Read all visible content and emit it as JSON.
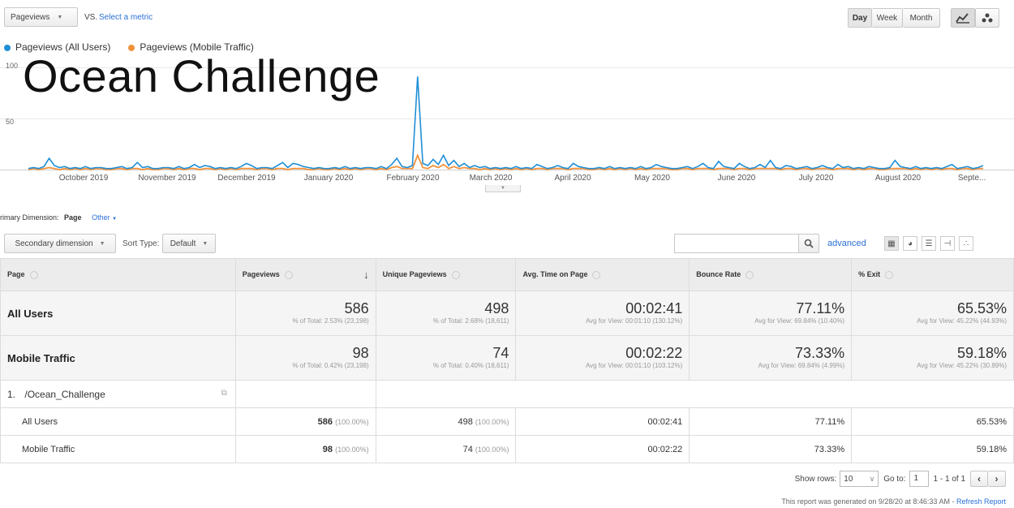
{
  "top": {
    "metric1": "Pageviews",
    "vs": "VS.",
    "select_metric": "Select a metric",
    "granularity": [
      "Day",
      "Week",
      "Month"
    ]
  },
  "legend": {
    "series1": "Pageviews (All Users)",
    "series2": "Pageviews (Mobile Traffic)",
    "series1_color": "#1f8fd6",
    "series2_color": "#f2913a"
  },
  "overlay_title": "Ocean Challenge",
  "chart_data": {
    "type": "line",
    "y_ticks": [
      "100",
      "50"
    ],
    "ylim": [
      0,
      100
    ],
    "x_labels": [
      "October 2019",
      "November 2019",
      "December 2019",
      "January 2020",
      "February 2020",
      "March 2020",
      "April 2020",
      "May 2020",
      "June 2020",
      "July 2020",
      "August 2020",
      "Septe..."
    ],
    "series": [
      {
        "name": "Pageviews (All Users)",
        "color": "#1f8fd6",
        "values": [
          1,
          2,
          1,
          3,
          11,
          4,
          2,
          3,
          1,
          2,
          1,
          3,
          1,
          2,
          2,
          1,
          1,
          2,
          3,
          1,
          2,
          7,
          2,
          3,
          1,
          1,
          2,
          2,
          1,
          3,
          1,
          2,
          5,
          2,
          4,
          3,
          1,
          2,
          1,
          2,
          1,
          3,
          6,
          4,
          1,
          2,
          2,
          1,
          4,
          7,
          2,
          6,
          5,
          3,
          2,
          1,
          2,
          1,
          1,
          2,
          1,
          3,
          1,
          2,
          1,
          2,
          2,
          1,
          3,
          1,
          5,
          11,
          3,
          2,
          4,
          91,
          6,
          4,
          10,
          5,
          14,
          4,
          9,
          3,
          6,
          2,
          4,
          2,
          3,
          1,
          2,
          1,
          2,
          1,
          3,
          1,
          2,
          1,
          5,
          3,
          1,
          2,
          4,
          2,
          1,
          6,
          3,
          2,
          1,
          1,
          2,
          1,
          3,
          1,
          2,
          1,
          2,
          1,
          3,
          1,
          2,
          5,
          3,
          2,
          1,
          1,
          2,
          3,
          1,
          3,
          6,
          2,
          1,
          8,
          3,
          2,
          1,
          6,
          3,
          1,
          2,
          5,
          2,
          9,
          2,
          1,
          4,
          3,
          1,
          2,
          3,
          1,
          2,
          4,
          2,
          1,
          5,
          2,
          3,
          1,
          2,
          1,
          3,
          2,
          1,
          1,
          2,
          9,
          3,
          2,
          1,
          3,
          1,
          2,
          1,
          2,
          1,
          3,
          5,
          1,
          2,
          3,
          1,
          2,
          4
        ]
      },
      {
        "name": "Pageviews (Mobile Traffic)",
        "color": "#f2913a",
        "values": [
          0,
          1,
          0,
          1,
          2,
          1,
          0,
          1,
          0,
          1,
          0,
          1,
          0,
          1,
          1,
          0,
          0,
          1,
          1,
          0,
          1,
          1,
          0,
          1,
          0,
          0,
          1,
          1,
          0,
          1,
          0,
          1,
          1,
          0,
          1,
          1,
          0,
          1,
          0,
          1,
          0,
          1,
          1,
          1,
          0,
          1,
          1,
          0,
          1,
          1,
          0,
          1,
          1,
          1,
          0,
          0,
          1,
          0,
          0,
          1,
          0,
          1,
          0,
          1,
          0,
          1,
          1,
          0,
          1,
          0,
          2,
          3,
          1,
          1,
          1,
          14,
          2,
          1,
          4,
          2,
          5,
          1,
          3,
          1,
          2,
          1,
          1,
          0,
          1,
          0,
          1,
          0,
          1,
          0,
          1,
          0,
          1,
          0,
          1,
          1,
          0,
          1,
          1,
          1,
          0,
          1,
          1,
          1,
          0,
          0,
          1,
          0,
          1,
          0,
          1,
          0,
          1,
          0,
          1,
          0,
          1,
          1,
          1,
          1,
          0,
          0,
          1,
          1,
          0,
          1,
          1,
          1,
          0,
          1,
          1,
          1,
          0,
          1,
          1,
          0,
          1,
          1,
          1,
          1,
          1,
          0,
          1,
          1,
          0,
          1,
          1,
          0,
          1,
          1,
          1,
          0,
          1,
          1,
          1,
          0,
          1,
          0,
          1,
          1,
          0,
          0,
          1,
          1,
          1,
          1,
          0,
          1,
          0,
          1,
          0,
          1,
          0,
          1,
          1,
          0,
          1,
          1,
          0,
          1,
          1
        ]
      }
    ]
  },
  "dimension": {
    "label": "Primary Dimension:",
    "value": "Page",
    "other": "Other"
  },
  "filters": {
    "secondary": "Secondary dimension",
    "sort_type_label": "Sort Type:",
    "sort_type_value": "Default",
    "advanced": "advanced"
  },
  "table": {
    "headers": [
      "Page",
      "Pageviews",
      "Unique Pageviews",
      "Avg. Time on Page",
      "Bounce Rate",
      "% Exit"
    ],
    "totals": [
      {
        "name": "All Users",
        "cells": [
          {
            "big": "586",
            "small": "% of Total: 2.53% (23,198)"
          },
          {
            "big": "498",
            "small": "% of Total: 2.68% (18,611)"
          },
          {
            "big": "00:02:41",
            "small": "Avg for View: 00:01:10 (130.12%)"
          },
          {
            "big": "77.11%",
            "small": "Avg for View: 69.84% (10.40%)"
          },
          {
            "big": "65.53%",
            "small": "Avg for View: 45.22% (44.93%)"
          }
        ]
      },
      {
        "name": "Mobile Traffic",
        "cells": [
          {
            "big": "98",
            "small": "% of Total: 0.42% (23,198)"
          },
          {
            "big": "74",
            "small": "% of Total: 0.40% (18,611)"
          },
          {
            "big": "00:02:22",
            "small": "Avg for View: 00:01:10 (103.12%)"
          },
          {
            "big": "73.33%",
            "small": "Avg for View: 69.84% (4.99%)"
          },
          {
            "big": "59.18%",
            "small": "Avg for View: 45.22% (30.89%)"
          }
        ]
      }
    ],
    "page_index": "1.",
    "page_path": "/Ocean_Challenge",
    "rows": [
      {
        "name": "All Users",
        "pv": "586",
        "pv_pct": "(100.00%)",
        "upv": "498",
        "upv_pct": "(100.00%)",
        "time": "00:02:41",
        "bounce": "77.11%",
        "exit": "65.53%"
      },
      {
        "name": "Mobile Traffic",
        "pv": "98",
        "pv_pct": "(100.00%)",
        "upv": "74",
        "upv_pct": "(100.00%)",
        "time": "00:02:22",
        "bounce": "73.33%",
        "exit": "59.18%"
      }
    ]
  },
  "footer": {
    "show_rows_label": "Show rows:",
    "show_rows_value": "10",
    "goto_label": "Go to:",
    "goto_value": "1",
    "range": "1 - 1 of 1",
    "report_text": "This report was generated on 9/28/20 at 8:46:33 AM -",
    "refresh": "Refresh Report"
  }
}
